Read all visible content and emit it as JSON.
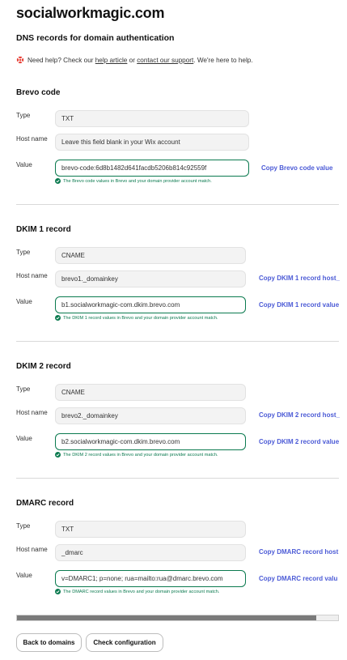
{
  "header": {
    "site": "socialworkmagic.com",
    "page_title": "DNS records for domain authentication"
  },
  "help": {
    "icon": "lifebuoy-icon",
    "prefix": "Need help? Check our ",
    "article_link": "help article",
    "middle": " or ",
    "support_link": "contact our support",
    "suffix": ". We're here to help."
  },
  "labels": {
    "type": "Type",
    "host": "Host name",
    "value": "Value"
  },
  "sections": {
    "brevo": {
      "title": "Brevo code",
      "type": "TXT",
      "host": "Leave this field blank in your Wix account",
      "value": "brevo-code:6d8b1482d641facdb5206b814c92559f",
      "copy_value": "Copy Brevo code value",
      "match": "The Brevo code values in Brevo and your domain provider account match."
    },
    "dkim1": {
      "title": "DKIM 1 record",
      "type": "CNAME",
      "host": "brevo1._domainkey",
      "value": "b1.socialworkmagic-com.dkim.brevo.com",
      "copy_host": "Copy DKIM 1 record host_",
      "copy_value": "Copy DKIM 1 record value",
      "match": "The DKIM 1 record values in Brevo and your domain provider account match."
    },
    "dkim2": {
      "title": "DKIM 2 record",
      "type": "CNAME",
      "host": "brevo2._domainkey",
      "value": "b2.socialworkmagic-com.dkim.brevo.com",
      "copy_host": "Copy DKIM 2 record host_",
      "copy_value": "Copy DKIM 2 record value",
      "match": "The DKIM 2 record values in Brevo and your domain provider account match."
    },
    "dmarc": {
      "title": "DMARC record",
      "type": "TXT",
      "host": "_dmarc",
      "value": "v=DMARC1; p=none; rua=mailto:rua@dmarc.brevo.com",
      "copy_host": "Copy DMARC record host",
      "copy_value": "Copy DMARC record valu",
      "match": "The DMARC record values in Brevo and your domain provider account match."
    }
  },
  "buttons": {
    "back": "Back to domains",
    "check": "Check configuration"
  },
  "colors": {
    "accent_link": "#4b5ad6",
    "success": "#0b7a4f"
  }
}
